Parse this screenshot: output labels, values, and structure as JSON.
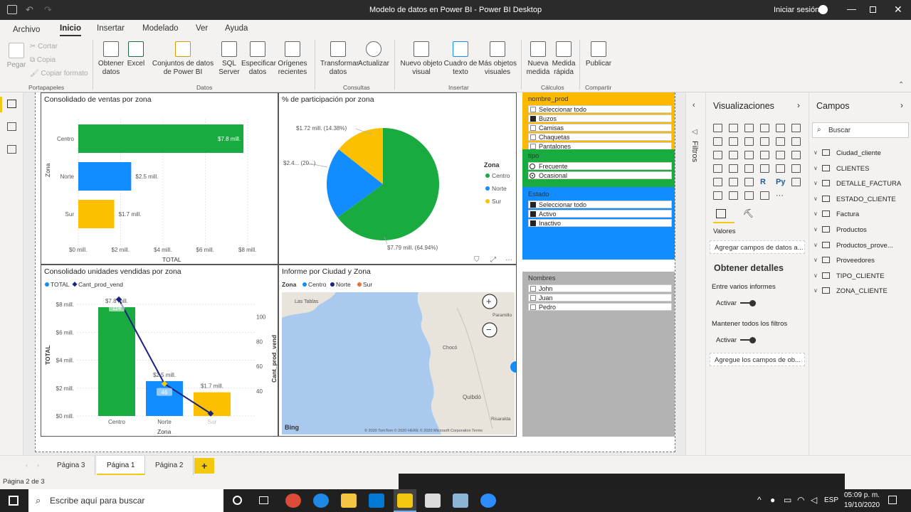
{
  "window": {
    "title": "Modelo de datos en Power BI - Power BI Desktop",
    "signin": "Iniciar sesión"
  },
  "menu": [
    "Archivo",
    "Inicio",
    "Insertar",
    "Modelado",
    "Ver",
    "Ayuda"
  ],
  "ribbon": {
    "clipboard": {
      "paste": "Pegar",
      "cut": "Cortar",
      "copy": "Copia",
      "format": "Copiar formato",
      "group": "Portapapeles"
    },
    "data": {
      "items": [
        "Obtener datos",
        "Excel",
        "Conjuntos de datos de Power BI",
        "SQL Server",
        "Especificar datos",
        "Orígenes recientes"
      ],
      "group": "Datos"
    },
    "queries": {
      "items": [
        "Transformar datos",
        "Actualizar"
      ],
      "group": "Consultas"
    },
    "insert": {
      "items": [
        "Nuevo objeto visual",
        "Cuadro de texto",
        "Más objetos visuales"
      ],
      "group": "Insertar"
    },
    "calc": {
      "items": [
        "Nueva medida",
        "Medida rápida"
      ],
      "group": "Cálculos"
    },
    "share": {
      "items": [
        "Publicar"
      ],
      "group": "Compartir"
    }
  },
  "visuals": {
    "bar": {
      "title": "Consolidado de ventas por zona",
      "ylabel": "Zona",
      "xlabel": "TOTAL",
      "ticks": [
        "$0 mill.",
        "$2 mill.",
        "$4 mill.",
        "$6 mill.",
        "$8 mill."
      ]
    },
    "pie": {
      "title": "% de participación por zona",
      "legend_title": "Zona",
      "labels": [
        "$1.72 mill. (14.38%)",
        "$2.4... (20...)",
        "$7.79 mill. (64.94%)"
      ]
    },
    "combo": {
      "title": "Consolidado unidades vendidas por zona",
      "legend": [
        "TOTAL",
        "Cant_prod_vend"
      ],
      "ylabel": "TOTAL",
      "y2label": "Cant_prod_vend",
      "xlabel": "Zona",
      "yticks": [
        "$8 mill.",
        "$6 mill.",
        "$4 mill.",
        "$2 mill.",
        "$0 mill."
      ],
      "y2ticks": [
        "100",
        "80",
        "60",
        "40"
      ],
      "bar_labels": [
        "$7.8 mill.",
        "$2.5 mill.",
        "$1.7 mill."
      ],
      "line_labels": [
        "114",
        "46",
        "22"
      ]
    },
    "map": {
      "title": "Informe por Ciudad y Zona",
      "legend_title": "Zona",
      "legend": [
        "Centro",
        "Norte",
        "Sur"
      ],
      "places": [
        "Las Tablas",
        "Chocó",
        "Quibdó",
        "Risaralda",
        "Paramillo"
      ],
      "provider": "Bing",
      "copyright": "© 2020 TomTom © 2020 HERE © 2020 Microsoft Corporation Terms"
    }
  },
  "chart_data": [
    {
      "type": "bar",
      "title": "Consolidado de ventas por zona",
      "categories": [
        "Centro",
        "Norte",
        "Sur"
      ],
      "values": [
        7.8,
        2.5,
        1.7
      ],
      "value_labels": [
        "$7.8 mill.",
        "$2.5 mill.",
        "$1.7 mill."
      ],
      "xlabel": "TOTAL",
      "ylabel": "Zona",
      "xlim": [
        0,
        8
      ],
      "colors": [
        "#1aab40",
        "#118dff",
        "#fdc000"
      ]
    },
    {
      "type": "pie",
      "title": "% de participación por zona",
      "categories": [
        "Centro",
        "Norte",
        "Sur"
      ],
      "values": [
        64.94,
        20.68,
        14.38
      ],
      "colors": [
        "#1aab40",
        "#118dff",
        "#fdc000"
      ]
    },
    {
      "type": "bar",
      "title": "Consolidado unidades vendidas por zona",
      "categories": [
        "Centro",
        "Norte",
        "Sur"
      ],
      "series": [
        {
          "name": "TOTAL",
          "values": [
            7.8,
            2.5,
            1.7
          ]
        },
        {
          "name": "Cant_prod_vend",
          "values": [
            114,
            46,
            22
          ]
        }
      ],
      "ylim": [
        0,
        8
      ],
      "y2lim": [
        20,
        110
      ],
      "colors": [
        "#1aab40",
        "#118dff",
        "#fdc000"
      ]
    }
  ],
  "slicers": {
    "prod": {
      "title": "nombre_prod",
      "items": [
        "Seleccionar todo",
        "Buzos",
        "Camisas",
        "Chaquetas",
        "Pantalones"
      ]
    },
    "tipo": {
      "title": "tipo",
      "items": [
        "Frecuente",
        "Ocasional"
      ]
    },
    "estado": {
      "title": "Estado",
      "items": [
        "Seleccionar todo",
        "Activo",
        "Inactivo"
      ]
    },
    "nombres": {
      "title": "Nombres",
      "items": [
        "John",
        "Juan",
        "Pedro"
      ]
    }
  },
  "filters_label": "Filtros",
  "viz_pane": {
    "title": "Visualizaciones",
    "values": "Valores",
    "add_fields": "Agregar campos de datos a...",
    "drill_title": "Obtener detalles",
    "cross_report": "Entre varios informes",
    "keep_filters": "Mantener todos los filtros",
    "on1": "Activar",
    "on2": "Activar",
    "drill_add": "Agregue los campos de ob..."
  },
  "fields_pane": {
    "title": "Campos",
    "search": "Buscar",
    "tables": [
      "Ciudad_cliente",
      "CLIENTES",
      "DETALLE_FACTURA",
      "ESTADO_CLIENTE",
      "Factura",
      "Productos",
      "Productos_prove...",
      "Proveedores",
      "TIPO_CLIENTE",
      "ZONA_CLIENTE"
    ]
  },
  "tabs": [
    "Página 3",
    "Página 1",
    "Página 2",
    "+"
  ],
  "status": "Página 2 de 3",
  "taskbar": {
    "search": "Escribe aquí para buscar",
    "lang": "ESP",
    "time": "05:09 p. m.",
    "date": "19/10/2020"
  }
}
